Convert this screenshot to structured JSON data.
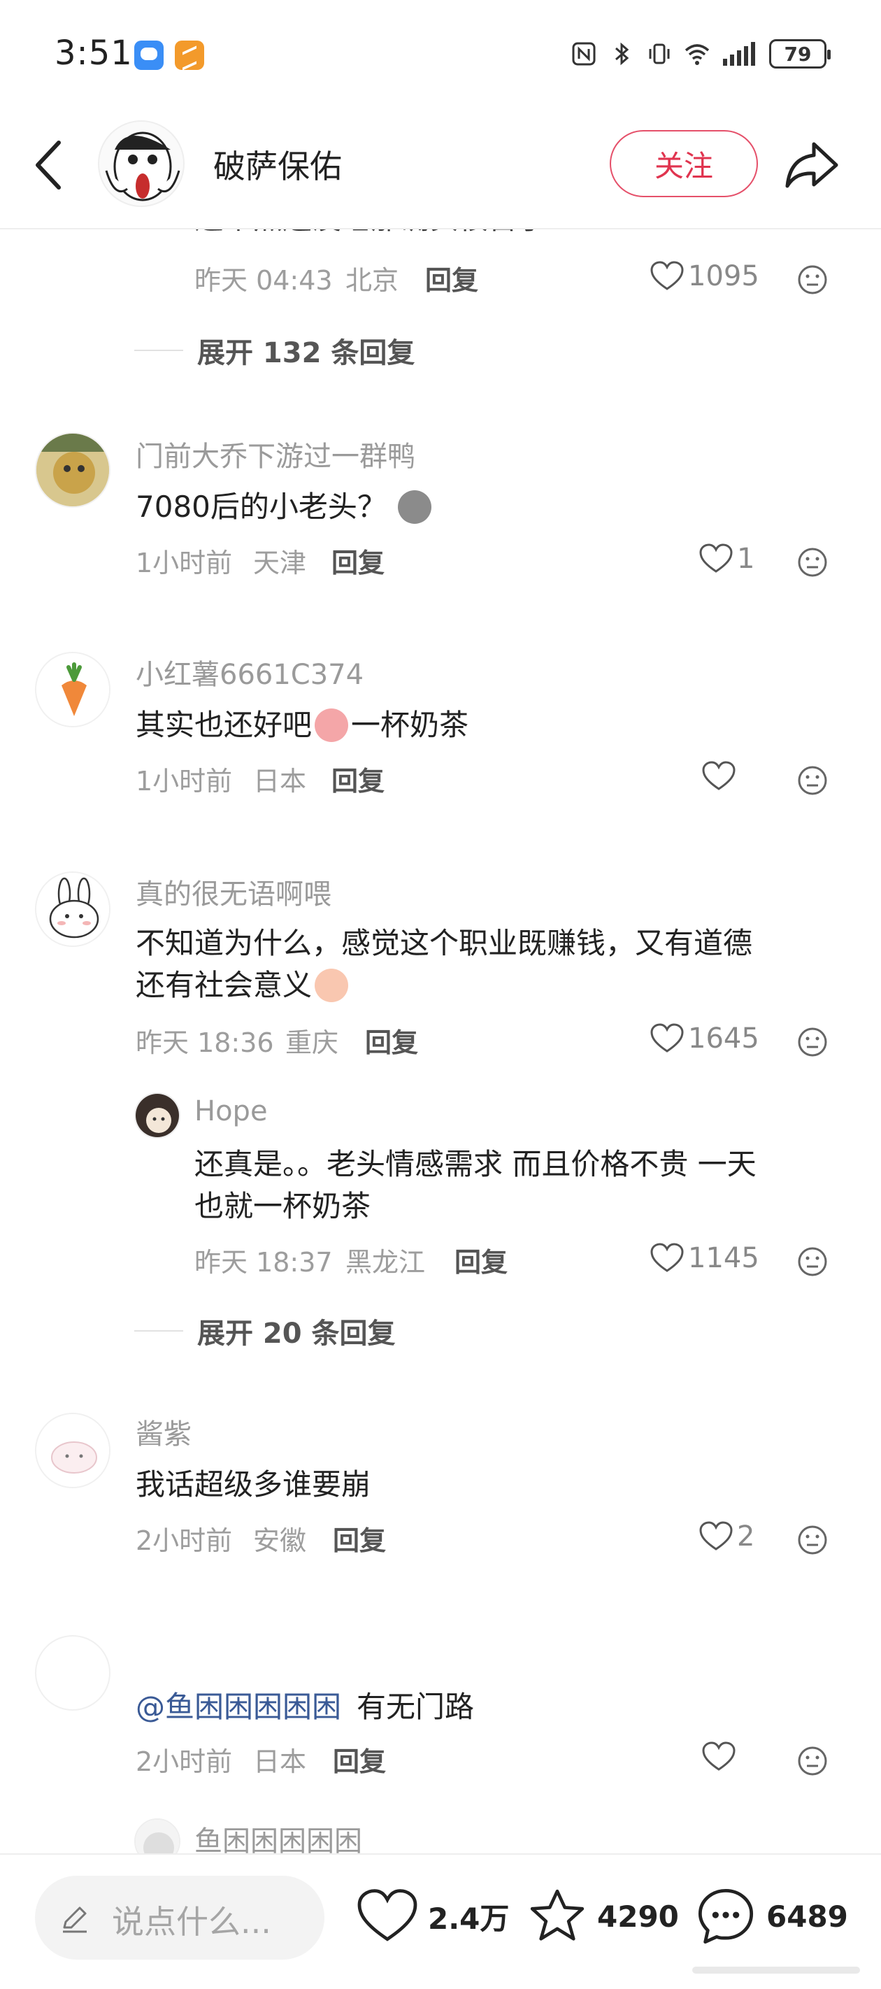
{
  "status_bar": {
    "time": "3:51",
    "battery": "79"
  },
  "header": {
    "name": "破萨保佑",
    "follow_label": "关注"
  },
  "comments": [
    {
      "partial_text": "这个点还没睡那确实很苦了",
      "time": "昨天 04:43",
      "location": "北京",
      "reply_label": "回复",
      "likes": "1095",
      "expand_label": "展开 132 条回复"
    },
    {
      "username": "门前大乔下游过一群鸭",
      "text": "7080后的小老头？",
      "time": "1小时前",
      "location": "天津",
      "reply_label": "回复",
      "likes": "1"
    },
    {
      "username": "小红薯6661C374",
      "text_a": "其实也还好吧",
      "text_b": "一杯奶茶",
      "time": "1小时前",
      "location": "日本",
      "reply_label": "回复",
      "likes": ""
    },
    {
      "username": "真的很无语啊喂",
      "text_line1": "不知道为什么，感觉这个职业既赚钱，又有道德",
      "text_line2": "还有社会意义",
      "time": "昨天 18:36",
      "location": "重庆",
      "reply_label": "回复",
      "likes": "1645",
      "reply": {
        "username": "Hope",
        "text_line1": "还真是。。老头情感需求 而且价格不贵 一天",
        "text_line2": "也就一杯奶茶",
        "time": "昨天 18:37",
        "location": "黑龙江",
        "reply_label": "回复",
        "likes": "1145"
      },
      "expand_label": "展开 20 条回复"
    },
    {
      "username": "酱紫",
      "text": "我话超级多谁要崩",
      "time": "2小时前",
      "location": "安徽",
      "reply_label": "回复",
      "likes": "2"
    },
    {
      "username": "",
      "mention": "@鱼困困困困困",
      "text": "有无门路",
      "time": "2小时前",
      "location": "日本",
      "reply_label": "回复",
      "likes": ""
    },
    {
      "username": "鱼困困困困困"
    }
  ],
  "bottom_bar": {
    "input_placeholder": "说点什么...",
    "likes": "2.4万",
    "favorites": "4290",
    "comments": "6489"
  },
  "colors": {
    "accent": "#e0344f",
    "mention": "#3a5a96"
  }
}
